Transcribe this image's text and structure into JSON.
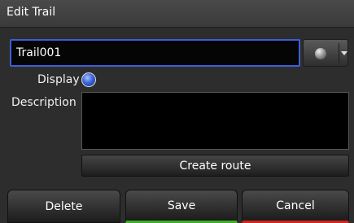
{
  "window": {
    "title": "Edit Trail"
  },
  "form": {
    "name_value": "Trail001",
    "display_label": "Display",
    "display_checked": true,
    "description_label": "Description",
    "description_value": "",
    "trail_color": "#9a9a9a"
  },
  "actions": {
    "create_route_label": "Create route",
    "delete_label": "Delete",
    "save_label": "Save",
    "cancel_label": "Cancel"
  },
  "colors": {
    "focus_border": "#3b5fd8",
    "save_accent": "#3fae2a",
    "cancel_accent": "#d0261e"
  }
}
